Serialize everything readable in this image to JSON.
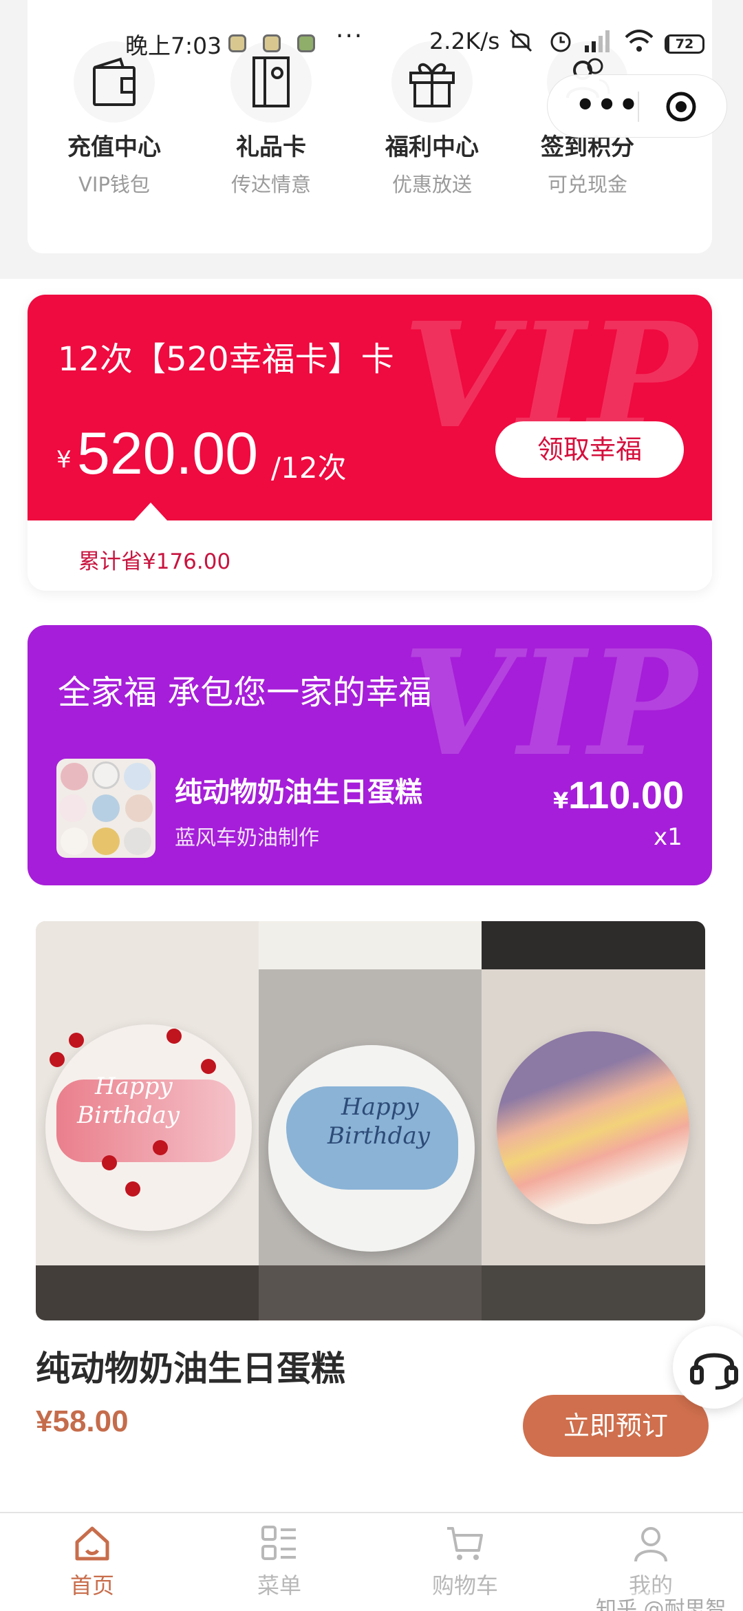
{
  "status_bar": {
    "time": "晚上7:03",
    "more": "···",
    "net_speed": "2.2K/s",
    "battery": "72"
  },
  "capsule": {
    "more_icon": "more-dots-icon",
    "close_icon": "target-close-icon"
  },
  "quick_menu": [
    {
      "title": "充值中心",
      "subtitle": "VIP钱包",
      "icon": "wallet-icon"
    },
    {
      "title": "礼品卡",
      "subtitle": "传达情意",
      "icon": "gift-card-icon"
    },
    {
      "title": "福利中心",
      "subtitle": "优惠放送",
      "icon": "gift-box-icon"
    },
    {
      "title": "签到积分",
      "subtitle": "可兑现金",
      "icon": "users-icon"
    }
  ],
  "vip_card": {
    "watermark": "VIP",
    "title": "12次【520幸福卡】卡",
    "price_symbol": "¥",
    "price": "520.00",
    "unit": "/12次",
    "button": "领取幸福",
    "saved": "累计省¥176.00",
    "color": "#ef0a3f"
  },
  "family_card": {
    "watermark": "VIP",
    "title": "全家福 承包您一家的幸福",
    "product_name": "纯动物奶油生日蛋糕",
    "maker": "蓝风车奶油制作",
    "price_symbol": "¥",
    "price": "110.00",
    "quantity": "x1",
    "color": "#a61ed9"
  },
  "banner": {
    "cake_texts": [
      "Happy",
      "Birthday",
      "Happy",
      "Birthday"
    ]
  },
  "product": {
    "name": "纯动物奶油生日蛋糕",
    "price": "¥58.00",
    "order_button": "立即预订",
    "accent": "#cf6f4d"
  },
  "tabbar": {
    "items": [
      {
        "label": "首页",
        "icon": "home-icon",
        "active": true
      },
      {
        "label": "菜单",
        "icon": "menu-grid-icon",
        "active": false
      },
      {
        "label": "购物车",
        "icon": "cart-icon",
        "active": false
      },
      {
        "label": "我的",
        "icon": "profile-icon",
        "active": false
      }
    ]
  },
  "watermark": "知乎 @耐思智慧"
}
